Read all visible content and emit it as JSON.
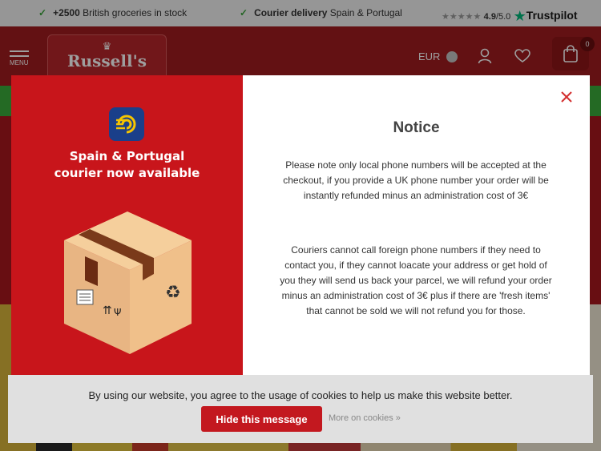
{
  "topbar": {
    "item1_strong": "+2500",
    "item1_text": "British groceries in stock",
    "item2_strong": "Courier delivery",
    "item2_text": "Spain & Portugal",
    "stars": "★★★★★",
    "rating_value": "4.9",
    "rating_scale": "/5.0",
    "trustpilot_label": "Trustpilot"
  },
  "header": {
    "menu_label": "MENU",
    "logo_text": "Russell's",
    "currency": "EUR",
    "cart_count": "0"
  },
  "modal": {
    "promo_title_line1": "Spain & Portugal",
    "promo_title_line2": "courier now available",
    "title": "Notice",
    "paragraph1": "Please note only local phone numbers will be accepted at the checkout, if you provide a UK phone number your order will be instantly refunded minus an administration cost of 3€",
    "paragraph2": "Couriers cannot call foreign phone numbers if they need to contact you, if they cannot loacate your address or get hold of you they will send us back your parcel, we will refund your order minus an administration cost of 3€ plus if there are 'fresh items' that cannot be sold we will not refund you for those."
  },
  "cookie": {
    "text": "By using our website, you agree to the usage of cookies to help us make this website better.",
    "hide_label": "Hide this message",
    "more_label": "More on cookies »"
  },
  "colors": {
    "brand_red": "#a01c1f",
    "promo_red": "#c8151b",
    "green": "#3bab3b",
    "trustpilot_green": "#00b67a"
  }
}
